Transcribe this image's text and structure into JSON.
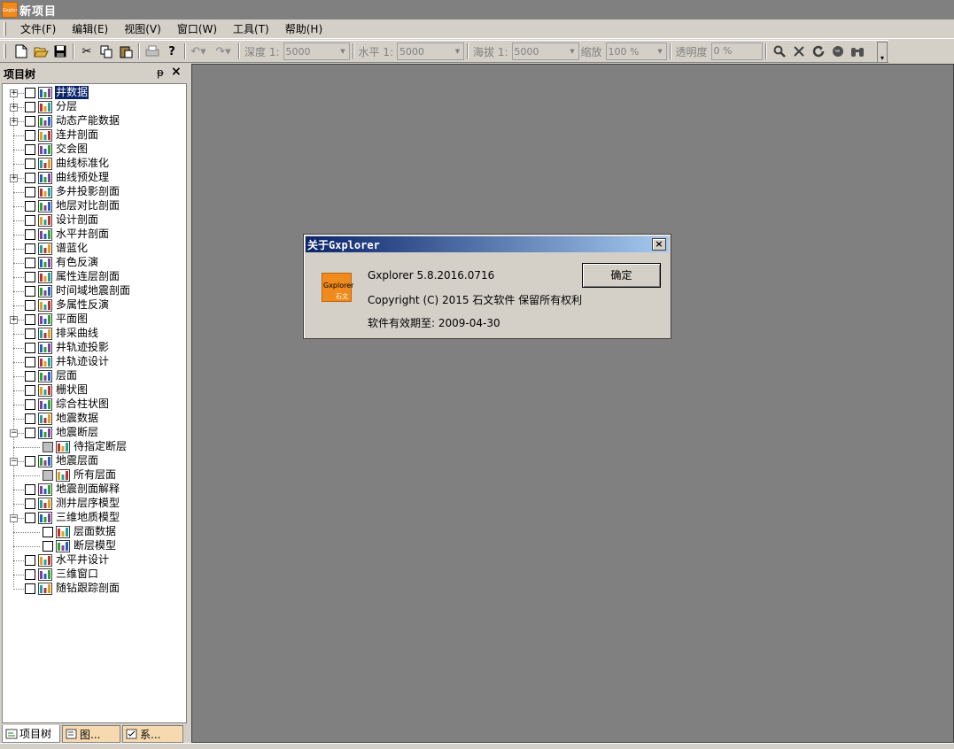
{
  "app": {
    "title": "新项目",
    "logo_text": "Gxplorer"
  },
  "menu": [
    "文件(F)",
    "编辑(E)",
    "视图(V)",
    "窗口(W)",
    "工具(T)",
    "帮助(H)"
  ],
  "toolbar": {
    "depth_label": "深度 1:",
    "depth_value": "5000",
    "horizontal_label": "水平 1:",
    "horizontal_value": "5000",
    "altitude_label": "海拔 1:",
    "altitude_value": "5000",
    "zoom_label": "缩放",
    "zoom_value": "100 %",
    "opacity_label": "透明度",
    "opacity_value": "0 %"
  },
  "pane": {
    "title": "项目树",
    "pin": "ᵽ",
    "close": "×"
  },
  "tree": [
    {
      "label": "井数据",
      "selected": true
    },
    {
      "label": "分层"
    },
    {
      "label": "动态产能数据"
    },
    {
      "label": "连井剖面"
    },
    {
      "label": "交会图"
    },
    {
      "label": "曲线标准化"
    },
    {
      "label": "曲线预处理"
    },
    {
      "label": "多井投影剖面"
    },
    {
      "label": "地层对比剖面"
    },
    {
      "label": "设计剖面"
    },
    {
      "label": "水平井剖面"
    },
    {
      "label": "谱蓝化"
    },
    {
      "label": "有色反演"
    },
    {
      "label": "属性连层剖面"
    },
    {
      "label": "时间域地震剖面"
    },
    {
      "label": "多属性反演"
    },
    {
      "label": "平面图"
    },
    {
      "label": "排采曲线"
    },
    {
      "label": "井轨迹投影"
    },
    {
      "label": "井轨迹设计"
    },
    {
      "label": "层面"
    },
    {
      "label": "栅状图"
    },
    {
      "label": "综合柱状图"
    },
    {
      "label": "地震数据"
    },
    {
      "label": "地震断层"
    },
    {
      "label": "待指定断层"
    },
    {
      "label": "地震层面"
    },
    {
      "label": "所有层面"
    },
    {
      "label": "地震剖面解释"
    },
    {
      "label": "测井层序模型"
    },
    {
      "label": "三维地质模型"
    },
    {
      "label": "层面数据"
    },
    {
      "label": "断层模型"
    },
    {
      "label": "水平井设计"
    },
    {
      "label": "三维窗口"
    },
    {
      "label": "随钻跟踪剖面"
    }
  ],
  "bottom_tabs": [
    "项目树",
    "图...",
    "系..."
  ],
  "dialog": {
    "title": "关于Gxplorer",
    "close": "×",
    "version": "Gxplorer 5.8.2016.0716",
    "copyright": "Copyright (C) 2015 石文软件 保留所有权利",
    "validity": "软件有效期至: 2009-04-30",
    "ok_button": "确定",
    "logo_line1": "Gxplorer",
    "logo_line2": "石文"
  },
  "colors": {
    "selection": "#0a246a",
    "accent_orange": "#f08a1c",
    "client_bg": "#808080"
  }
}
